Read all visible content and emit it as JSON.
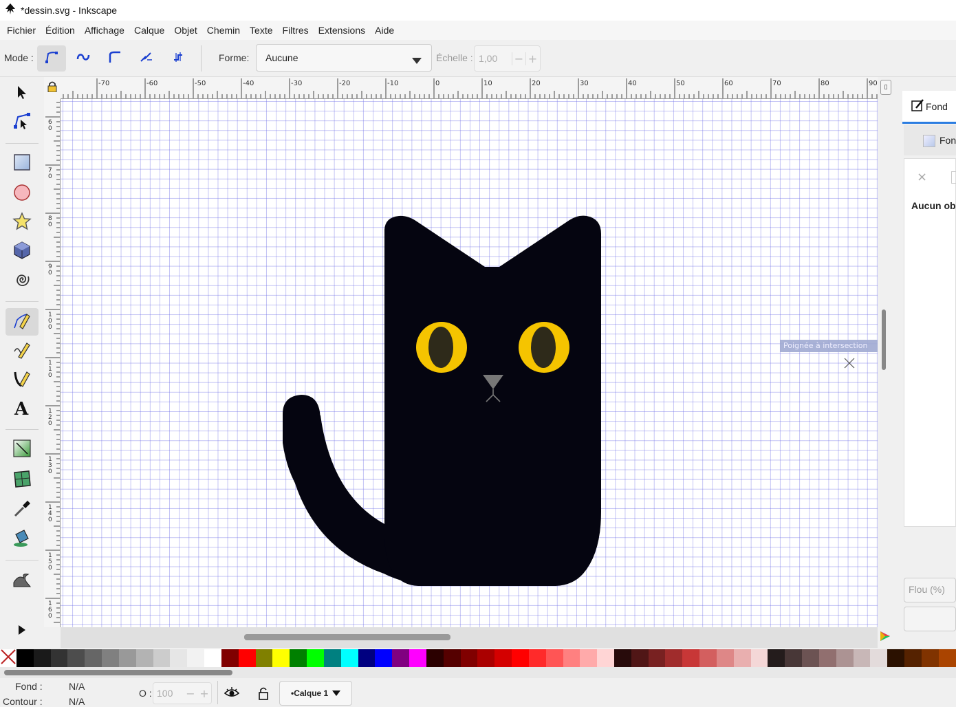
{
  "window": {
    "title": "*dessin.svg - Inkscape"
  },
  "menu": [
    "Fichier",
    "Édition",
    "Affichage",
    "Calque",
    "Objet",
    "Chemin",
    "Texte",
    "Filtres",
    "Extensions",
    "Aide"
  ],
  "toolbar": {
    "mode_label": "Mode :",
    "modes": [
      "regular-bezier-mode-icon",
      "spiro-mode-icon",
      "bspline-mode-icon",
      "zigzag-mode-icon",
      "paraxial-mode-icon"
    ],
    "forme_label": "Forme:",
    "forme_value": "Aucune",
    "echelle_label": "Échelle :",
    "echelle_value": "1,00",
    "minus": "−",
    "plus": "+"
  },
  "tools": [
    "selector-icon",
    "node-icon",
    "rect-icon",
    "ellipse-icon",
    "star-icon",
    "box3d-icon",
    "spiral-icon",
    "pen-icon",
    "pencil-icon",
    "calligraphy-icon",
    "text-icon",
    "gradient-icon",
    "mesh-icon",
    "dropper-icon",
    "paint-bucket-icon",
    "tweak-icon",
    "expand-icon"
  ],
  "ruler_top": [
    "-70",
    "-60",
    "-50",
    "-40",
    "-30",
    "-20",
    "-10",
    "0",
    "10",
    "20",
    "30",
    "40",
    "50",
    "60",
    "70",
    "80",
    "90"
  ],
  "ruler_left": [
    "60",
    "70",
    "80",
    "90",
    "100",
    "110",
    "120",
    "130",
    "140",
    "150",
    "160"
  ],
  "canvas": {
    "snap_tooltip": "Poignée à intersection",
    "cat_color": "#050510",
    "eye_color": "#f5c400",
    "pupil_color": "#2e2a1a",
    "nose_color": "#777777"
  },
  "dock": {
    "tab1": "Fond",
    "tab2": "Fon",
    "no_object": "Aucun ob",
    "blur_label": "Flou (%)",
    "close": "×"
  },
  "palette": [
    "#000000",
    "#1a1a1a",
    "#333333",
    "#4d4d4d",
    "#666666",
    "#808080",
    "#999999",
    "#b3b3b3",
    "#cccccc",
    "#e6e6e6",
    "#f2f2f2",
    "#ffffff",
    "#800000",
    "#ff0000",
    "#808000",
    "#ffff00",
    "#008000",
    "#00ff00",
    "#008080",
    "#00ffff",
    "#000080",
    "#0000ff",
    "#800080",
    "#ff00ff",
    "#2b0000",
    "#550000",
    "#800000",
    "#aa0000",
    "#d40000",
    "#ff0000",
    "#ff2a2a",
    "#ff5555",
    "#ff8080",
    "#ffaaaa",
    "#ffd5d5",
    "#280b0b",
    "#501616",
    "#782121",
    "#a02c2c",
    "#c83737",
    "#d35f5f",
    "#de8787",
    "#e9afaf",
    "#f4d7d7",
    "#241c1c",
    "#483737",
    "#6c5353",
    "#916f6f",
    "#ac9393",
    "#c8b7b7",
    "#e3dbdb",
    "#2b1100",
    "#552200",
    "#803300",
    "#aa4400"
  ],
  "status": {
    "fond_label": "Fond :",
    "fond_value": "N/A",
    "contour_label": "Contour :",
    "contour_value": "N/A",
    "opacity_label": "O :",
    "opacity_value": "100",
    "layer_label": "•Calque 1"
  }
}
